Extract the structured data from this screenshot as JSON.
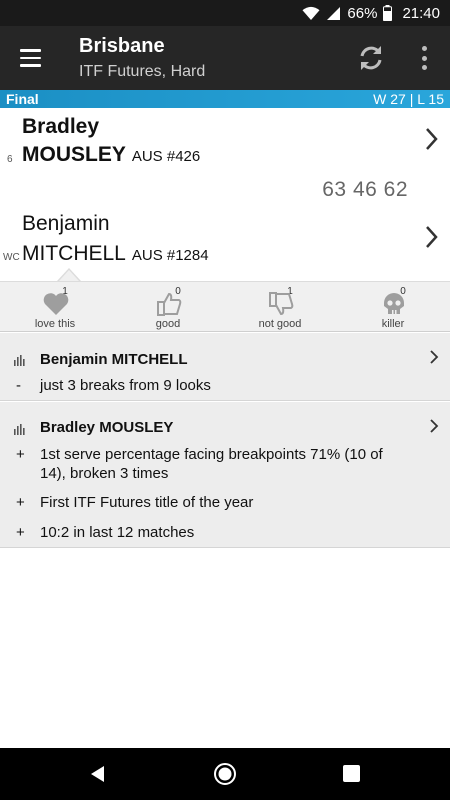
{
  "status_bar": {
    "battery": "66%",
    "time": "21:40"
  },
  "app_bar": {
    "title": "Brisbane",
    "subtitle": "ITF Futures, Hard"
  },
  "result_band": {
    "status": "Final",
    "record": "W 27 | L 15"
  },
  "players": [
    {
      "seed": "6",
      "first_name": "Bradley",
      "last_name": "MOUSLEY",
      "country_rank": "AUS #426"
    },
    {
      "seed": "WC",
      "first_name": "Benjamin",
      "last_name": "MITCHELL",
      "country_rank": "AUS #1284"
    }
  ],
  "score": "63 46 62",
  "reactions": [
    {
      "count": "1",
      "label": "love this",
      "icon": "heart-icon"
    },
    {
      "count": "0",
      "label": "good",
      "icon": "thumbs-up-icon"
    },
    {
      "count": "1",
      "label": "not good",
      "icon": "thumbs-down-icon"
    },
    {
      "count": "0",
      "label": "killer",
      "icon": "skull-icon"
    }
  ],
  "notes": [
    {
      "player": "Benjamin MITCHELL",
      "items": [
        {
          "sign": "-",
          "text": "just 3 breaks from 9 looks"
        }
      ]
    },
    {
      "player": "Bradley MOUSLEY",
      "items": [
        {
          "sign": "+",
          "text": "1st serve percentage facing breakpoints 71% (10 of 14), broken 3 times"
        },
        {
          "sign": "+",
          "text": "First ITF Futures title of the year"
        },
        {
          "sign": "+",
          "text": "10:2 in last 12 matches"
        }
      ]
    }
  ],
  "colors": {
    "appbar": "#262626",
    "band": "#2196c9",
    "reaction_icon": "#9e9e9e"
  }
}
